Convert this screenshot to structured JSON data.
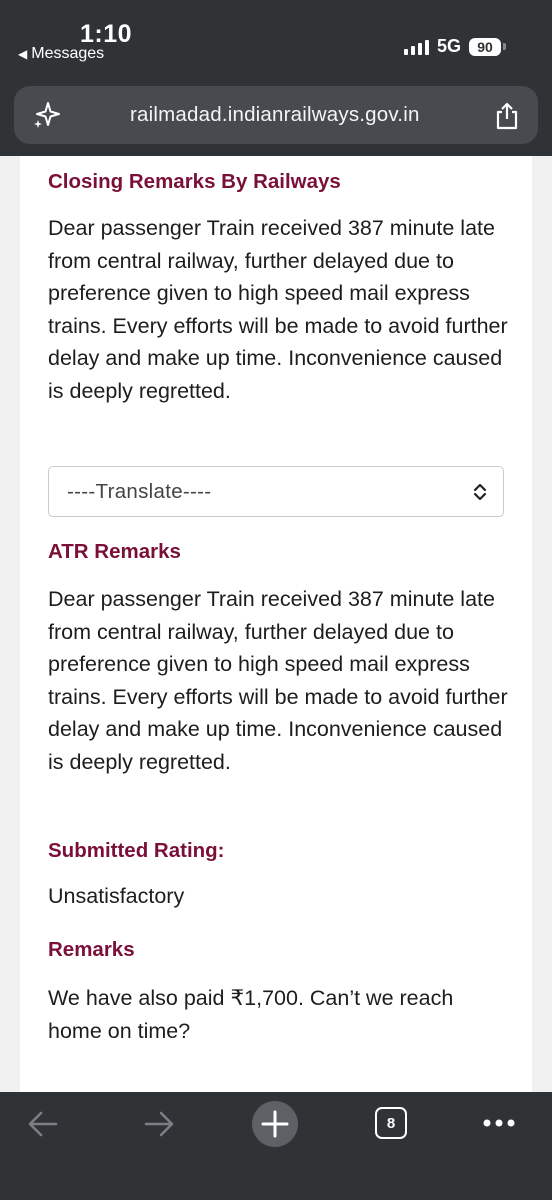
{
  "status": {
    "time": "1:10",
    "back_label": "Messages",
    "network": "5G",
    "battery": "90"
  },
  "browser": {
    "url": "railmadad.indianrailways.gov.in",
    "tab_count": "8"
  },
  "content": {
    "closing_heading": "Closing Remarks By Railways",
    "closing_text": "Dear passenger Train received 387 minute late from central railway, further delayed due to preference given to high speed mail express trains. Every efforts will be made to avoid further delay and make up time. Inconvenience caused is deeply regretted.",
    "translate_select": "----Translate----",
    "atr_heading": "ATR Remarks",
    "atr_text": "Dear passenger Train received 387 minute late from central railway, further delayed due to preference given to high speed mail express trains. Every efforts will be made to avoid further delay and make up time. Inconvenience caused is deeply regretted.",
    "rating_heading": "Submitted Rating:",
    "rating_value": "Unsatisfactory",
    "remarks_heading": "Remarks",
    "remarks_text": "We have also paid ₹1,700. Can’t we reach home on time?"
  },
  "icons": {
    "url_left": "sparkle-icon",
    "url_right": "share-icon",
    "toolbar": [
      "back-arrow-icon",
      "forward-arrow-icon",
      "plus-icon",
      "tabs-icon",
      "more-icon"
    ]
  },
  "colors": {
    "heading": "#7a1037",
    "chrome": "#2f3336"
  }
}
